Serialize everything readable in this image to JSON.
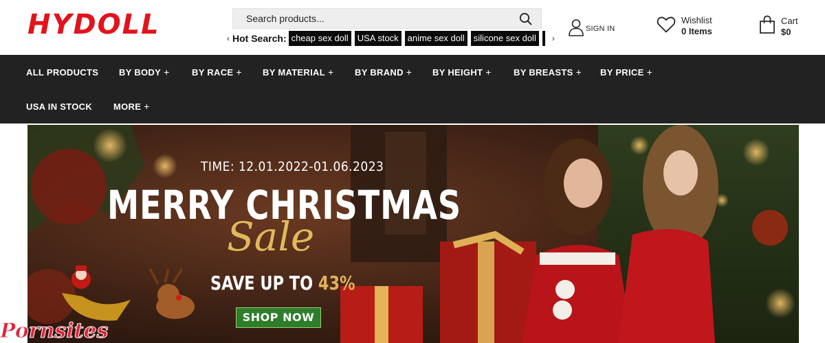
{
  "brand": {
    "logo_text": "HYDOLL",
    "accent": "#e3121b"
  },
  "search": {
    "placeholder": "Search products...",
    "icon": "search-icon"
  },
  "hot_search": {
    "label": "Hot Search:",
    "prev_arrow": "‹",
    "next_arrow": "›",
    "tags": [
      "cheap sex doll",
      "USA stock",
      "anime sex doll",
      "silicone sex doll"
    ]
  },
  "account": {
    "signin_label": "SIGN IN",
    "icon": "user-icon"
  },
  "wishlist": {
    "title": "Wishlist",
    "count": "0 Items",
    "icon": "heart-icon"
  },
  "cart": {
    "title": "Cart",
    "total": "$0",
    "icon": "shopping-bag-icon"
  },
  "nav": {
    "row1": [
      {
        "label": "ALL PRODUCTS",
        "plus": ""
      },
      {
        "label": "BY BODY",
        "plus": "+"
      },
      {
        "label": "BY RACE",
        "plus": "+"
      },
      {
        "label": "BY MATERIAL",
        "plus": "+"
      },
      {
        "label": "BY BRAND",
        "plus": "+"
      },
      {
        "label": "BY HEIGHT",
        "plus": "+"
      },
      {
        "label": "BY BREASTS",
        "plus": "+"
      },
      {
        "label": "BY PRICE",
        "plus": "+"
      }
    ],
    "row2": [
      {
        "label": "USA IN STOCK",
        "plus": ""
      },
      {
        "label": "MORE",
        "plus": "+"
      }
    ]
  },
  "banner": {
    "time": "TIME: 12.01.2022-01.06.2023",
    "title": "MERRY CHRISTMAS",
    "script": "Sale",
    "save_prefix": "SAVE UP TO ",
    "save_pct": "43%",
    "cta": "SHOP NOW"
  },
  "watermark": {
    "text": "Pornsites"
  },
  "colors": {
    "nav_bg": "#222222",
    "tag_bg": "#0b0b0b",
    "cta_bg": "#2d7d2a",
    "gold": "#e1b95c"
  }
}
